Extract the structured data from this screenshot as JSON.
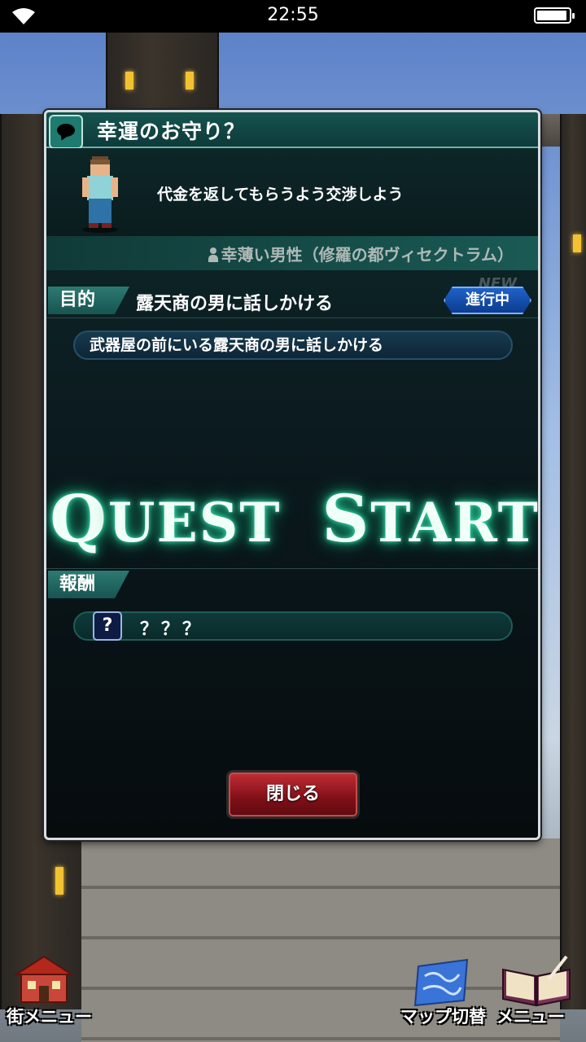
{
  "status_bar": {
    "time": "22:55"
  },
  "dialog": {
    "title": "幸運のお守り？",
    "message": "代金を返してもらうよう交渉しよう",
    "quest_giver": "幸薄い男性（修羅の都ヴィセクトラム）",
    "objective_label": "目的",
    "objective": "露天商の男に話しかける",
    "new_tag": "NEW",
    "status": "進行中",
    "objective_detail": "武器屋の前にいる露天商の男に話しかける",
    "banner_first": {
      "initial": "Q",
      "rest": "UEST"
    },
    "banner_second": {
      "initial": "S",
      "rest": "TART"
    },
    "reward_label": "報酬",
    "reward_icon": "?",
    "reward": "？？？",
    "close_button": "閉じる"
  },
  "bottom_menu": {
    "town_menu": "街メニュー",
    "map_switch": "マップ切替",
    "menu": "メニュー"
  },
  "colors": {
    "panel": "#0b1a1e",
    "title_bar": "#15534f",
    "badge": "#1f62c8",
    "close_button": "#c22d35",
    "glow": "#22c48f"
  },
  "icons": [
    "wifi-icon",
    "battery-icon",
    "speech-bubble-icon",
    "person-icon",
    "question-icon",
    "town-house-icon",
    "map-scroll-icon",
    "menu-book-icon"
  ]
}
